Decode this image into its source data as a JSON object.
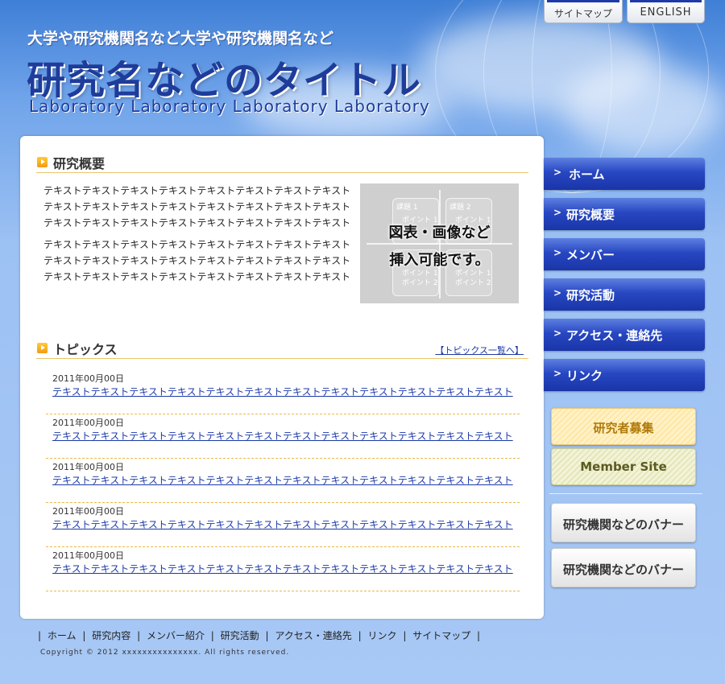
{
  "utility": {
    "sitemap_label": "サイトマップ",
    "english_label": "ENGLISH"
  },
  "header": {
    "subtitle": "大学や研究機関名など大学や研究機関名など",
    "title": "研究名などのタイトル",
    "laboratory": "Laboratory Laboratory Laboratory Laboratory"
  },
  "overview": {
    "heading": "研究概要",
    "paragraphs": [
      "テキストテキストテキストテキストテキストテキストテキストテキスト",
      "テキストテキストテキストテキストテキストテキストテキストテキスト",
      "テキストテキストテキストテキストテキストテキストテキストテキスト",
      "テキストテキストテキストテキストテキストテキストテキストテキスト",
      "テキストテキストテキストテキストテキストテキストテキストテキスト",
      "テキストテキストテキストテキストテキストテキストテキストテキスト"
    ],
    "figure": {
      "box1_title": "課題 1",
      "box2_title": "課題 2",
      "point1": "ポイント 1",
      "point2": "ポイント 2",
      "caption_line1": "図表・画像など",
      "caption_line2": "挿入可能です。"
    }
  },
  "topics": {
    "heading": "トピックス",
    "more_link": "【トピックス一覧へ】",
    "items": [
      {
        "date": "2011年00月00日",
        "text": "テキストテキストテキストテキストテキストテキストテキストテキストテキストテキストテキストテキスト"
      },
      {
        "date": "2011年00月00日",
        "text": "テキストテキストテキストテキストテキストテキストテキストテキストテキストテキストテキストテキスト"
      },
      {
        "date": "2011年00月00日",
        "text": "テキストテキストテキストテキストテキストテキストテキストテキストテキストテキストテキストテキスト"
      },
      {
        "date": "2011年00月00日",
        "text": "テキストテキストテキストテキストテキストテキストテキストテキストテキストテキストテキストテキスト"
      },
      {
        "date": "2011年00月00日",
        "text": "テキストテキストテキストテキストテキストテキストテキストテキストテキストテキストテキストテキスト"
      }
    ]
  },
  "nav": {
    "arrow": ">",
    "items": [
      {
        "label": "ホーム"
      },
      {
        "label": "研究概要"
      },
      {
        "label": "メンバー"
      },
      {
        "label": "研究活動"
      },
      {
        "label": "アクセス・連絡先"
      },
      {
        "label": "リンク"
      }
    ]
  },
  "banners": {
    "recruit": "研究者募集",
    "member_site": "Member Site",
    "institution1": "研究機関などのバナー",
    "institution2": "研究機関などのバナー"
  },
  "footer": {
    "sep": "|",
    "links": [
      "ホーム",
      "研究内容",
      "メンバー紹介",
      "研究活動",
      "アクセス・連絡先",
      "リンク",
      "サイトマップ"
    ],
    "copyright": "Copyright © 2012 xxxxxxxxxxxxxxx. All rights reserved."
  }
}
